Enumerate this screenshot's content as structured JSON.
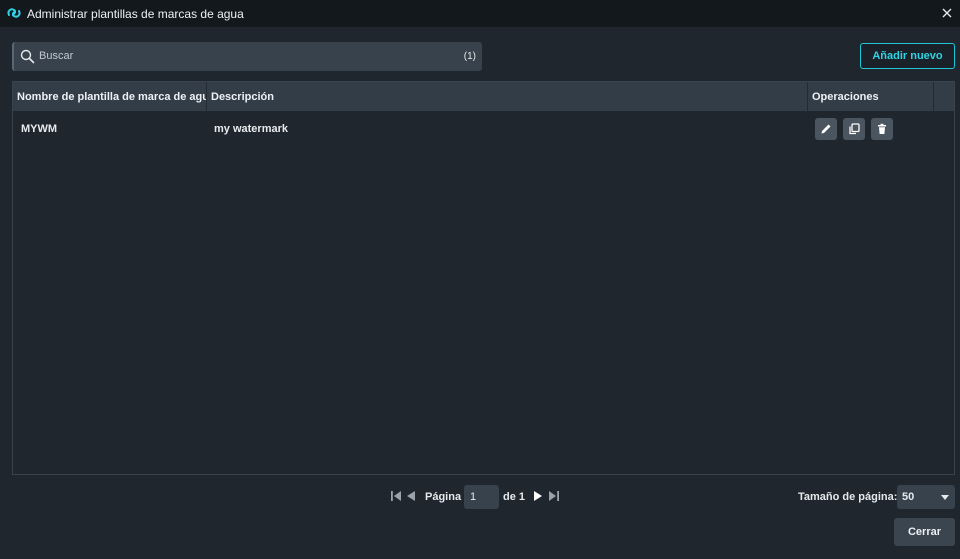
{
  "window": {
    "title": "Administrar plantillas de marcas de agua",
    "icon": "swirl-logo-icon",
    "close_icon": "close-icon"
  },
  "search": {
    "placeholder": "Buscar",
    "value": "",
    "count": "(1)"
  },
  "toolbar": {
    "add_label": "Añadir nuevo"
  },
  "table": {
    "columns": [
      "Nombre de plantilla de marca de agu",
      "Descripción",
      "Operaciones"
    ],
    "rows": [
      {
        "name": "MYWM",
        "description": "my watermark",
        "operations": [
          "edit-icon",
          "duplicate-icon",
          "delete-icon"
        ]
      }
    ]
  },
  "pagination": {
    "page_label": "Página",
    "current_page": "1",
    "of_label": "de 1",
    "page_size_label": "Tamaño de página:",
    "page_size": "50"
  },
  "footer": {
    "close_label": "Cerrar"
  },
  "colors": {
    "background": "#1f262e",
    "titlebar": "#13181d",
    "accent": "#21c6d9",
    "header": "#333d48"
  }
}
